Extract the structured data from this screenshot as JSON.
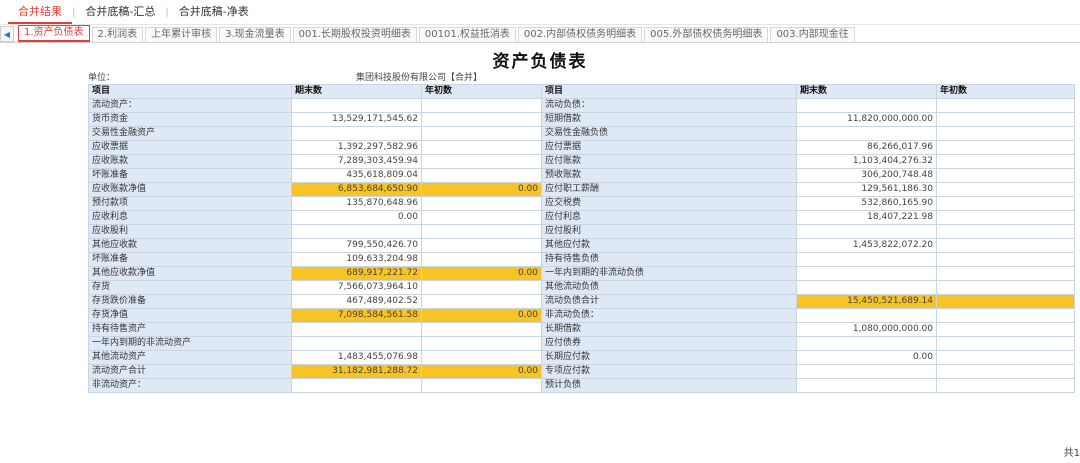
{
  "top_tabs": [
    {
      "label": "合并结果",
      "active": true
    },
    {
      "label": "合并底稿-汇总",
      "active": false
    },
    {
      "label": "合并底稿-净表",
      "active": false
    }
  ],
  "sheet_tabs": [
    {
      "label": "1.资产负债表",
      "active": true
    },
    {
      "label": "2.利润表",
      "active": false
    },
    {
      "label": "上年累计审核",
      "active": false
    },
    {
      "label": "3.现金流量表",
      "active": false
    },
    {
      "label": "001.长期股权投资明细表",
      "active": false
    },
    {
      "label": "00101.权益抵消表",
      "active": false
    },
    {
      "label": "002.内部债权债务明细表",
      "active": false
    },
    {
      "label": "005.外部债权债务明细表",
      "active": false
    },
    {
      "label": "003.内部现金往",
      "active": false
    }
  ],
  "report": {
    "title": "资产负债表",
    "unit_label": "单位：",
    "company": "集团科技股份有限公司【合并】",
    "headers": [
      "项目",
      "期末数",
      "年初数",
      "项目",
      "期末数",
      "年初数"
    ]
  },
  "rows": [
    {
      "l_item": "流动资产：",
      "l_end": "",
      "l_begin": "",
      "r_item": "流动负债：",
      "r_end": "",
      "r_begin": ""
    },
    {
      "l_item": "货币资金",
      "l_end": "13,529,171,545.62",
      "l_begin": "",
      "r_item": "短期借款",
      "r_end": "11,820,000,000.00",
      "r_begin": ""
    },
    {
      "l_item": "交易性金融资产",
      "l_end": "",
      "l_begin": "",
      "r_item": "交易性金融负债",
      "r_end": "",
      "r_begin": ""
    },
    {
      "l_item": "应收票据",
      "l_end": "1,392,297,582.96",
      "l_begin": "",
      "r_item": "应付票据",
      "r_end": "86,266,017.96",
      "r_begin": ""
    },
    {
      "l_item": "应收账款",
      "l_end": "7,289,303,459.94",
      "l_begin": "",
      "r_item": "应付账款",
      "r_end": "1,103,404,276.32",
      "r_begin": ""
    },
    {
      "l_item": "坏账准备",
      "l_end": "435,618,809.04",
      "l_begin": "",
      "r_item": "预收账款",
      "r_end": "306,200,748.48",
      "r_begin": ""
    },
    {
      "l_item": "应收账款净值",
      "l_end": "6,853,684,650.90",
      "l_begin": "0.00",
      "r_item": "应付职工薪酬",
      "r_end": "129,561,186.30",
      "r_begin": "",
      "l_hl": true
    },
    {
      "l_item": "预付款项",
      "l_end": "135,870,648.96",
      "l_begin": "",
      "r_item": "应交税费",
      "r_end": "532,860,165.90",
      "r_begin": ""
    },
    {
      "l_item": "应收利息",
      "l_end": "0.00",
      "l_begin": "",
      "r_item": "应付利息",
      "r_end": "18,407,221.98",
      "r_begin": ""
    },
    {
      "l_item": "应收股利",
      "l_end": "",
      "l_begin": "",
      "r_item": "应付股利",
      "r_end": "",
      "r_begin": ""
    },
    {
      "l_item": "其他应收款",
      "l_end": "799,550,426.70",
      "l_begin": "",
      "r_item": "其他应付款",
      "r_end": "1,453,822,072.20",
      "r_begin": ""
    },
    {
      "l_item": "坏账准备",
      "l_end": "109,633,204.98",
      "l_begin": "",
      "r_item": "持有待售负债",
      "r_end": "",
      "r_begin": ""
    },
    {
      "l_item": "其他应收款净值",
      "l_end": "689,917,221.72",
      "l_begin": "0.00",
      "r_item": "一年内到期的非流动负债",
      "r_end": "",
      "r_begin": "",
      "l_hl": true
    },
    {
      "l_item": "存货",
      "l_end": "7,566,073,964.10",
      "l_begin": "",
      "r_item": "其他流动负债",
      "r_end": "",
      "r_begin": ""
    },
    {
      "l_item": "存货跌价准备",
      "l_end": "467,489,402.52",
      "l_begin": "",
      "r_item": "流动负债合计",
      "r_end": "15,450,521,689.14",
      "r_begin": "",
      "r_hl": true
    },
    {
      "l_item": "存货净值",
      "l_end": "7,098,584,561.58",
      "l_begin": "0.00",
      "r_item": "非流动负债：",
      "r_end": "",
      "r_begin": "",
      "l_hl": true
    },
    {
      "l_item": "持有待售资产",
      "l_end": "",
      "l_begin": "",
      "r_item": "长期借款",
      "r_end": "1,080,000,000.00",
      "r_begin": ""
    },
    {
      "l_item": "一年内到期的非流动资产",
      "l_end": "",
      "l_begin": "",
      "r_item": "应付债券",
      "r_end": "",
      "r_begin": ""
    },
    {
      "l_item": "其他流动资产",
      "l_end": "1,483,455,076.98",
      "l_begin": "",
      "r_item": "长期应付款",
      "r_end": "0.00",
      "r_begin": ""
    },
    {
      "l_item": "流动资产合计",
      "l_end": "31,182,981,288.72",
      "l_begin": "0.00",
      "r_item": "专项应付款",
      "r_end": "",
      "r_begin": "",
      "l_hl": true
    },
    {
      "l_item": "非流动资产：",
      "l_end": "",
      "l_begin": "",
      "r_item": "预计负债",
      "r_end": "",
      "r_begin": ""
    }
  ],
  "corner_text": "共1",
  "colors": {
    "accent": "#e0403a",
    "header_bg": "#dfe9f5",
    "highlight": "#f7c325"
  }
}
